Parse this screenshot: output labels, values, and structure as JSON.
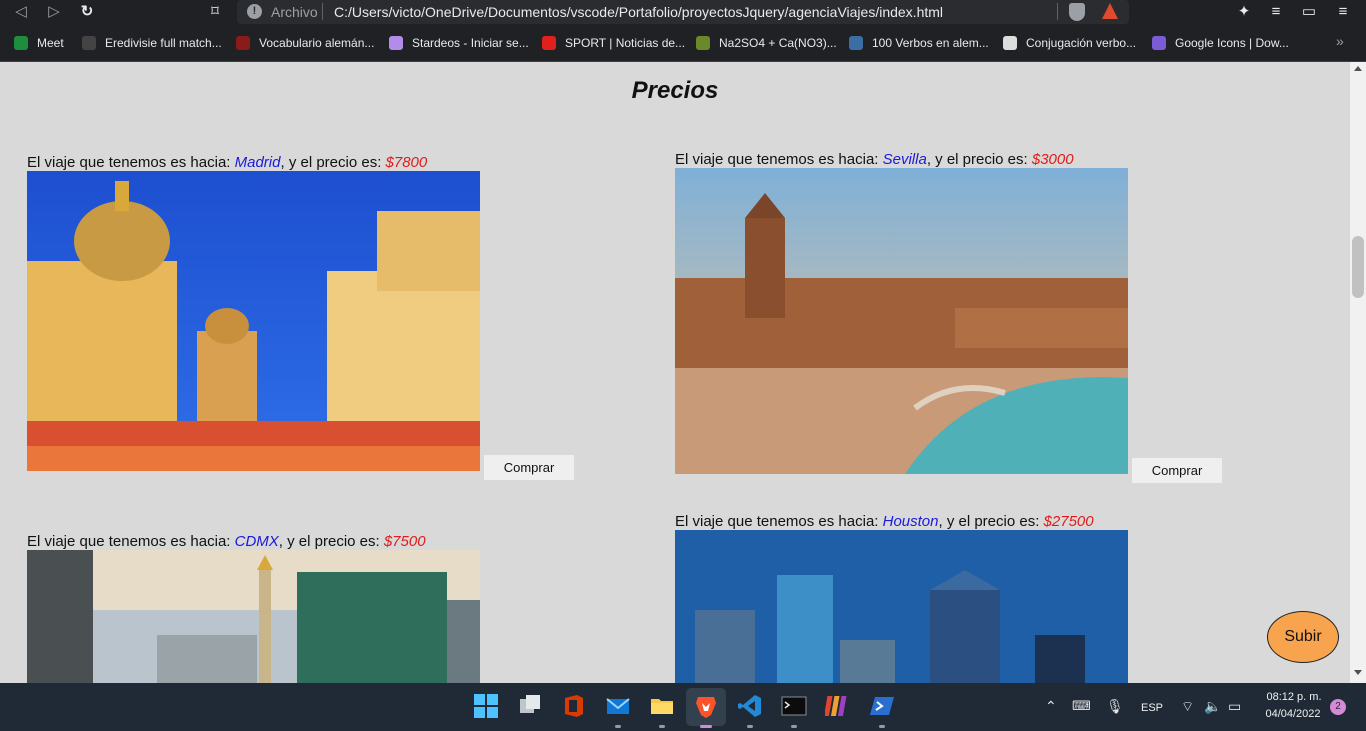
{
  "browser": {
    "back_icon": "◁",
    "forward_icon": "▷",
    "reload_icon": "↻",
    "bookmark_icon": "⌑",
    "url_prefix": "Archivo",
    "url": "C:/Users/victo/OneDrive/Documentos/vscode/Portafolio/proyectosJquery/agenciaViajes/index.html",
    "bookmarks": [
      {
        "label": "Meet",
        "color": "#1e8e3e"
      },
      {
        "label": "Eredivisie full match...",
        "color": "#444444"
      },
      {
        "label": "Vocabulario alemán...",
        "color": "#8b1a1a"
      },
      {
        "label": "Stardeos - Iniciar se...",
        "color": "#b38be8"
      },
      {
        "label": "SPORT | Noticias de...",
        "color": "#e0201b"
      },
      {
        "label": "Na2SO4 + Ca(NO3)...",
        "color": "#6a8a2a"
      },
      {
        "label": "100 Verbos en alem...",
        "color": "#3a6ea5"
      },
      {
        "label": "Conjugación verbo...",
        "color": "#dddddd"
      },
      {
        "label": "Google Icons | Dow...",
        "color": "#7b5bd6"
      }
    ],
    "more_bookmarks": "»"
  },
  "page": {
    "title": "Precios",
    "trip_prefix": "El viaje que tenemos es hacia: ",
    "price_prefix": ", y el precio es: ",
    "buy_label": "Comprar",
    "scroll_top_label": "Subir",
    "trips": [
      {
        "city": "Madrid",
        "price": "$7800"
      },
      {
        "city": "Sevilla",
        "price": "$3000"
      },
      {
        "city": "CDMX",
        "price": "$7500"
      },
      {
        "city": "Houston",
        "price": "$27500"
      }
    ]
  },
  "taskbar": {
    "language": "ESP",
    "time": "08:12 p. m.",
    "date": "04/04/2022",
    "notifications": "2"
  }
}
